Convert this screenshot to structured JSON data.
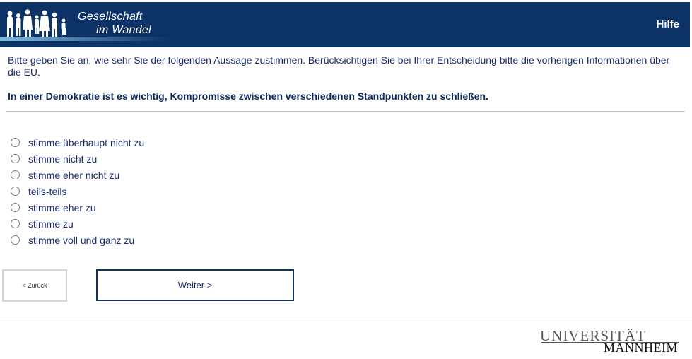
{
  "header": {
    "logo_line1": "Gesellschaft",
    "logo_line2": "im Wandel",
    "help_label": "Hilfe"
  },
  "question": {
    "intro": "Bitte geben Sie an, wie sehr Sie der folgenden Aussage zustimmen. Berücksichtigen Sie bei Ihrer Entscheidung bitte die vorherigen Informationen über die EU.",
    "statement": "In einer Demokratie ist es wichtig, Kompromisse zwischen verschiedenen Standpunkten zu schließen."
  },
  "options": [
    {
      "label": "stimme überhaupt nicht zu"
    },
    {
      "label": "stimme nicht zu"
    },
    {
      "label": "stimme eher nicht zu"
    },
    {
      "label": "teils-teils"
    },
    {
      "label": "stimme eher zu"
    },
    {
      "label": "stimme zu"
    },
    {
      "label": "stimme voll und ganz zu"
    }
  ],
  "nav": {
    "back_label": "< Zurück",
    "next_label": "Weiter >"
  },
  "footer": {
    "uni_line1": "UNIVERSITÄT",
    "uni_line2": "MANNHEIM"
  },
  "colors": {
    "header_bg": "#0c3266",
    "text": "#1a2b6d"
  }
}
